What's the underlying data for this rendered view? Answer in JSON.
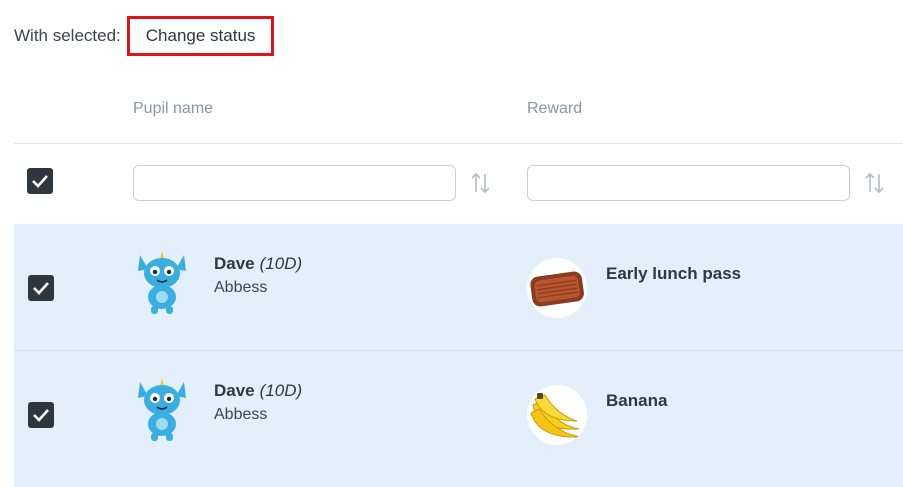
{
  "bulk": {
    "label": "With selected:",
    "button": "Change status"
  },
  "columns": {
    "pupil": "Pupil name",
    "reward": "Reward"
  },
  "filters": {
    "select_all_checked": true,
    "pupil_filter_value": "",
    "reward_filter_value": ""
  },
  "rows": [
    {
      "checked": true,
      "first_name": "Dave",
      "class": "(10D)",
      "surname": "Abbess",
      "reward": "Early lunch pass",
      "reward_icon": "lunch-tray-icon"
    },
    {
      "checked": true,
      "first_name": "Dave",
      "class": "(10D)",
      "surname": "Abbess",
      "reward": "Banana",
      "reward_icon": "banana-icon"
    }
  ],
  "colors": {
    "highlight": "#e0141b",
    "row_selected": "#e3f0fb",
    "checkbox": "#2e3640",
    "avatar": "#3aaee0"
  }
}
